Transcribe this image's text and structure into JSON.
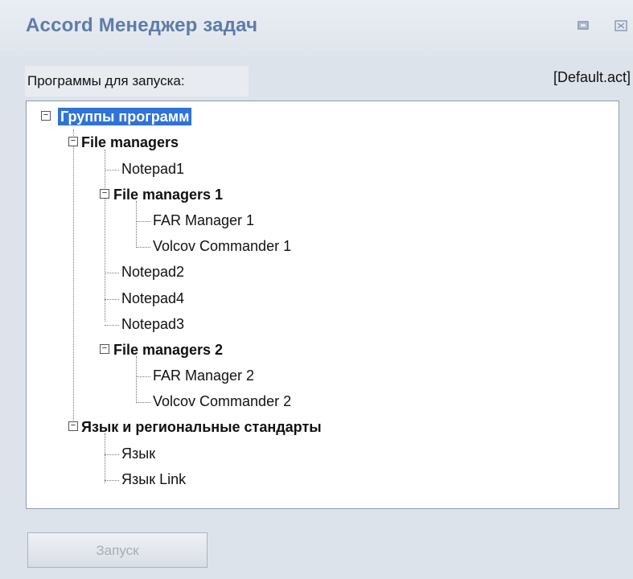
{
  "window": {
    "title": "Accord Менеджер задач",
    "restore_icon": "restore-window-icon",
    "close_icon": "close-icon"
  },
  "header": {
    "programs_label": "Программы для запуска:",
    "config_file": "[Default.act]"
  },
  "tree": {
    "root": "Группы программ",
    "file_managers": "File managers",
    "notepad1": "Notepad1",
    "file_managers_1": "File managers 1",
    "far_manager_1": "FAR Manager 1",
    "volcov_commander_1": "Volcov Commander 1",
    "notepad2": "Notepad2",
    "notepad4": "Notepad4",
    "notepad3": "Notepad3",
    "file_managers_2": "File managers 2",
    "far_manager_2": "FAR Manager 2",
    "volcov_commander_2": "Volcov Commander 2",
    "language_regional": "Язык и региональные стандарты",
    "language": "Язык",
    "language_link": "Язык Link"
  },
  "footer": {
    "launch_button": "Запуск"
  },
  "colors": {
    "title": "#5e7ca8",
    "selection": "#2f73d6",
    "background": "#dde3ea"
  }
}
